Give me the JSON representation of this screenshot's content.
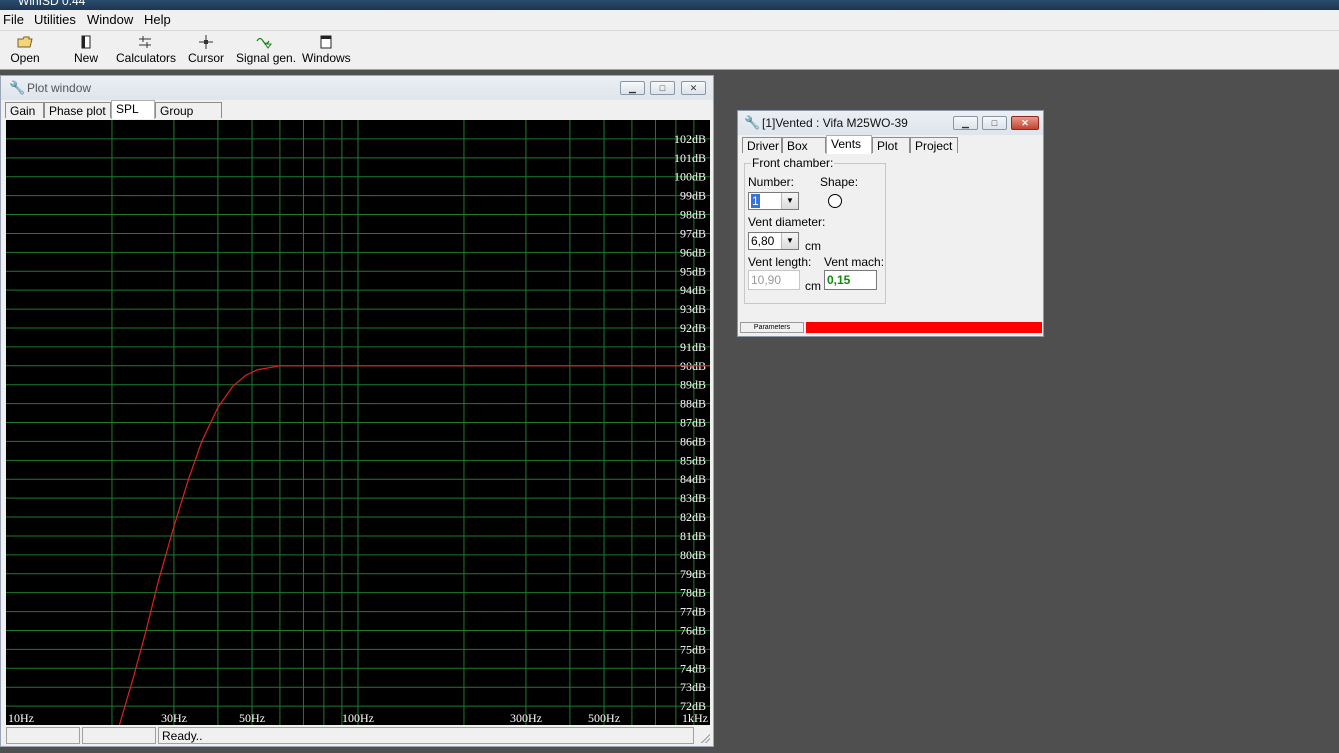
{
  "app": {
    "title": "WinISD 0.44"
  },
  "menu": [
    "File",
    "Utilities",
    "Window",
    "Help"
  ],
  "toolbar": [
    {
      "label": "Open",
      "icon": "open-folder-icon"
    },
    {
      "label": "New",
      "icon": "new-document-icon"
    },
    {
      "label": "Calculators",
      "icon": "calculator-icon"
    },
    {
      "label": "Cursor",
      "icon": "cursor-icon"
    },
    {
      "label": "Signal gen.",
      "icon": "signal-generator-icon"
    },
    {
      "label": "Windows",
      "icon": "window-icon"
    }
  ],
  "plot_window": {
    "title": "Plot window",
    "tabs": [
      "Gain",
      "Phase plot",
      "SPL",
      "Group delay"
    ],
    "active_tab": "SPL",
    "status": [
      "",
      "",
      "Ready.."
    ]
  },
  "chart_data": {
    "type": "line",
    "x_scale": "log",
    "xlim": [
      10,
      1000
    ],
    "ylim": [
      71,
      103
    ],
    "x_tick_labels": [
      "10Hz",
      "30Hz",
      "50Hz",
      "100Hz",
      "300Hz",
      "500Hz",
      "1kHz"
    ],
    "x_tick_values": [
      10,
      30,
      50,
      100,
      300,
      500,
      1000
    ],
    "y_tick_labels": [
      "102dB",
      "101dB",
      "100dB",
      "99dB",
      "98dB",
      "97dB",
      "96dB",
      "95dB",
      "94dB",
      "93dB",
      "92dB",
      "91dB",
      "90dB",
      "89dB",
      "88dB",
      "87dB",
      "86dB",
      "85dB",
      "84dB",
      "83dB",
      "82dB",
      "81dB",
      "80dB",
      "79dB",
      "78dB",
      "77dB",
      "76dB",
      "75dB",
      "74dB",
      "73dB",
      "72dB"
    ],
    "y_tick_values": [
      102,
      101,
      100,
      99,
      98,
      97,
      96,
      95,
      94,
      93,
      92,
      91,
      90,
      89,
      88,
      87,
      86,
      85,
      84,
      83,
      82,
      81,
      80,
      79,
      78,
      77,
      76,
      75,
      74,
      73,
      72
    ],
    "grid": true,
    "colors": {
      "background": "#000000",
      "grid": "#1f7a2a",
      "curve": "#e02020",
      "labels": "#ffffff"
    },
    "series": [
      {
        "x": [
          21,
          23,
          25,
          27,
          30,
          33,
          36,
          40,
          44,
          48,
          52,
          56,
          60,
          65,
          70,
          80,
          100,
          200,
          500,
          1000
        ],
        "y": [
          71,
          73.5,
          76,
          78.5,
          81.5,
          84,
          86,
          87.8,
          88.9,
          89.5,
          89.8,
          89.9,
          90,
          90,
          90,
          90,
          90,
          90,
          90,
          90
        ]
      }
    ]
  },
  "vented_window": {
    "title": "[1]Vented : Vifa M25WO-39",
    "tabs": [
      "Driver",
      "Box",
      "Vents",
      "Plot",
      "Project"
    ],
    "active_tab": "Vents",
    "group_label": "Front chamber:",
    "number_label": "Number:",
    "number_value": "1",
    "shape_label": "Shape:",
    "shape_icon": "circle-icon",
    "diameter_label": "Vent diameter:",
    "diameter_value": "6,80",
    "diameter_unit": "cm",
    "length_label": "Vent length:",
    "length_value": "10,90",
    "length_unit": "cm",
    "mach_label": "Vent mach:",
    "mach_value": "0,15",
    "status_label": "Parameters",
    "status_color": "#ff0000"
  }
}
